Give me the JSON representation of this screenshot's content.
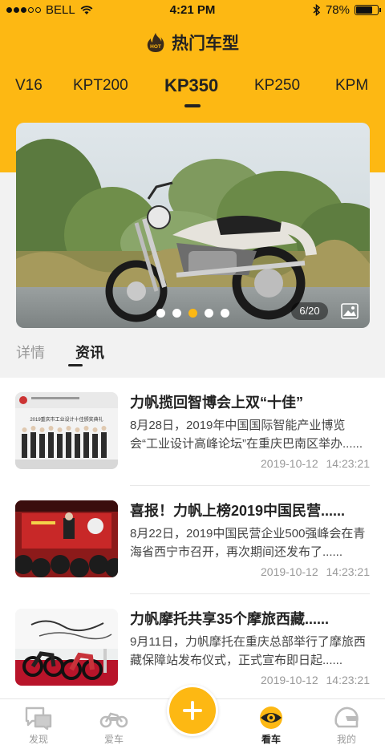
{
  "status_bar": {
    "carrier": "BELL",
    "time": "4:21 PM",
    "battery": "78%",
    "battery_level": 0.78
  },
  "header": {
    "title": "热门车型",
    "hot_icon_text": "HOT"
  },
  "model_tabs": [
    {
      "label": "V16"
    },
    {
      "label": "KPT200"
    },
    {
      "label": "KP350"
    },
    {
      "label": "KP250"
    },
    {
      "label": "KPM"
    }
  ],
  "active_model": "KP350",
  "gallery": {
    "counter": "6/20",
    "active_index": 2,
    "dot_count": 5
  },
  "sub_tabs": [
    {
      "label": "详情"
    },
    {
      "label": "资讯"
    }
  ],
  "news": [
    {
      "headline": "力帆揽回智博会上双“十佳”",
      "summary": "8月28日，2019年中国国际智能产业博览会“工业设计高峰论坛”在重庆巴南区举办......",
      "date": "2019-10-12 14:23:21",
      "thumb_caption": "2019重庆市工业设计十佳颁奖典礼"
    },
    {
      "headline": "喜报！力帆上榜2019中国民营......",
      "summary": "8月22日，2019中国民营企业500强峰会在青海省西宁市召开，再次期间还发布了......",
      "date": "2019-10-12 14:23:21",
      "thumb_caption": ""
    },
    {
      "headline": "力帆摩托共享35个摩旅西藏......",
      "summary": " 9月11日，力帆摩托在重庆总部举行了摩旅西藏保障站发布仪式，正式宣布即日起......",
      "date": "2019-10-12 14:23:21",
      "thumb_caption": ""
    }
  ],
  "bottom_nav": [
    {
      "label": "发现",
      "icon": "chat-icon"
    },
    {
      "label": "爱车",
      "icon": "motorcycle-icon"
    },
    {
      "label": "看车",
      "icon": "eye-icon"
    },
    {
      "label": "我的",
      "icon": "helmet-icon"
    }
  ],
  "active_nav": "看车",
  "colors": {
    "accent": "#FDB813",
    "text": "#222222",
    "muted": "#999999"
  }
}
